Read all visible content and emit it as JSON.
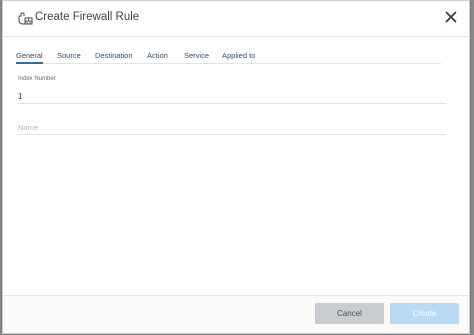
{
  "modal": {
    "title": "Create Firewall Rule",
    "icon": "firewall-rule-icon",
    "close_icon": "close-icon"
  },
  "tabs": [
    {
      "label": "General",
      "active": true
    },
    {
      "label": "Source",
      "active": false
    },
    {
      "label": "Destination",
      "active": false
    },
    {
      "label": "Action",
      "active": false
    },
    {
      "label": "Service",
      "active": false
    },
    {
      "label": "Applied to",
      "active": false
    }
  ],
  "form": {
    "index_number": {
      "label": "Index Number",
      "value": "1"
    },
    "name": {
      "placeholder": "Name",
      "value": ""
    }
  },
  "footer": {
    "cancel_label": "Cancel",
    "create_label": "Create"
  },
  "colors": {
    "accent": "#2b6ea8",
    "tab_text": "#2d4f72",
    "create_disabled": "#b9daf5",
    "cancel_bg": "#c9cdd2"
  }
}
